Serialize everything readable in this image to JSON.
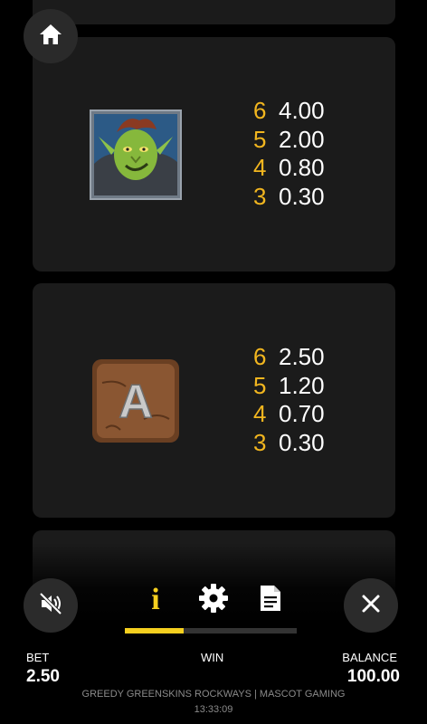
{
  "paytable": {
    "symbols": [
      {
        "name": "goblin",
        "pays": [
          {
            "count": "6",
            "value": "4.00"
          },
          {
            "count": "5",
            "value": "2.00"
          },
          {
            "count": "4",
            "value": "0.80"
          },
          {
            "count": "3",
            "value": "0.30"
          }
        ]
      },
      {
        "name": "A",
        "letter": "A",
        "pays": [
          {
            "count": "6",
            "value": "2.50"
          },
          {
            "count": "5",
            "value": "1.20"
          },
          {
            "count": "4",
            "value": "0.70"
          },
          {
            "count": "3",
            "value": "0.30"
          }
        ]
      }
    ]
  },
  "tabs": {
    "info_glyph": "i",
    "active": "info",
    "progress_fraction": 0.34
  },
  "footer": {
    "bet_label": "BET",
    "bet_value": "2.50",
    "win_label": "WIN",
    "balance_label": "BALANCE",
    "balance_value": "100.00",
    "game_title": "GREEDY GREENSKINS ROCKWAYS | MASCOT GAMING",
    "time": "13:33:09"
  },
  "colors": {
    "accent": "#f5cf1f",
    "pay_count": "#f2b61f",
    "card": "#1b1b1b",
    "button": "#2b2b2b"
  },
  "icons": [
    "home-icon",
    "mute-icon",
    "info-icon",
    "settings-icon",
    "paytable-icon",
    "close-icon"
  ]
}
